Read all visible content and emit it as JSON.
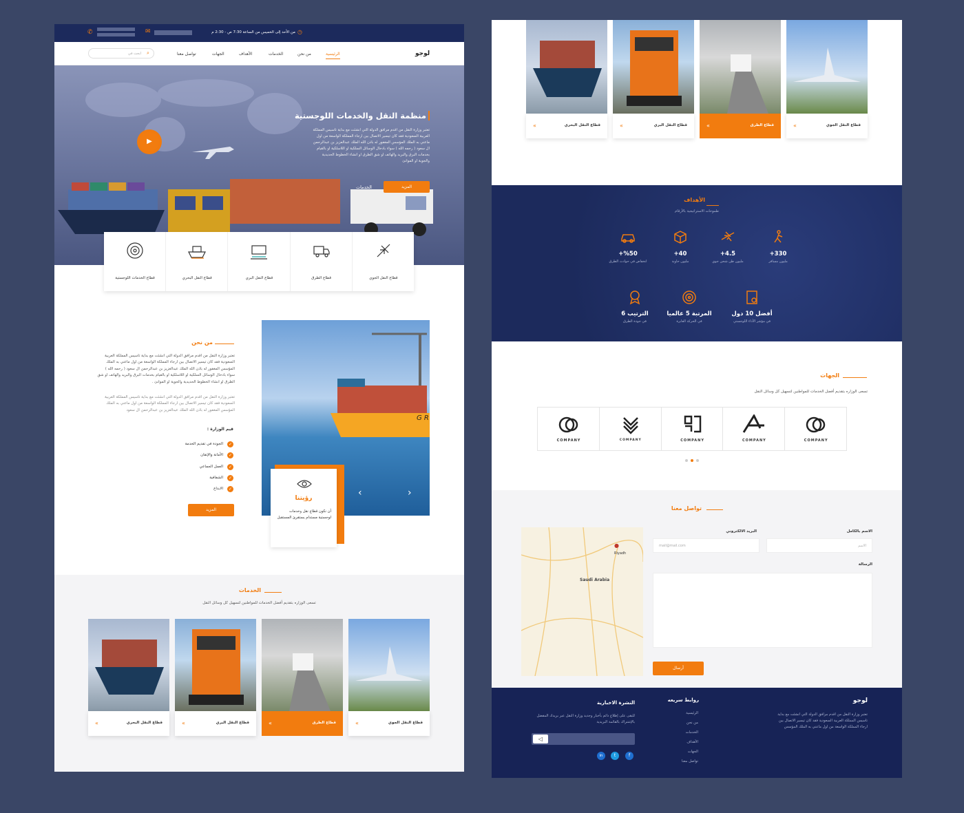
{
  "topbar": {
    "hours": "من الأحد إلى الخميس من الساعة 7:30 ص - 2:30 م"
  },
  "nav": {
    "logo": "لوجو",
    "items": [
      "الرئيسية",
      "من نحن",
      "الخدمات",
      "الأهداف",
      "الجهات",
      "تواصل معنا"
    ],
    "search_placeholder": "ابحث في"
  },
  "hero": {
    "title": "منظمة النقل والخدمات اللوجستية",
    "body": "تعتبر وزارة النقل من اقدم مرافق الدولة التي انشئت مع بداية تاسيس المملكة العربية السعودية فقد كان تيسير الاتصال بين ارجاء المملكة الواسعة من اول ماعني به الملك المؤسس المغفور له باذن الله الملك عبدالعزيز بن عبدالرحمن ال سعود ( رحمه الله ) سواء بادخال الوسائل السلكية او اللاسلكية او بالقيام بخدمات البرق والبريد والهاتف او شق الطرق او انشاء الخطوط الحديدية والجوية او الموانئ",
    "more": "المزيد",
    "services": "الخدمات"
  },
  "sectors": [
    {
      "label": "قطاع الخدمات اللوجستية",
      "icon": "logistics-icon"
    },
    {
      "label": "قطاع النقل البحري",
      "icon": "ship-icon"
    },
    {
      "label": "قطاع النقل البري",
      "icon": "train-icon"
    },
    {
      "label": "قطاع الطرق",
      "icon": "truck-icon"
    },
    {
      "label": "قطاع النقل الجوي",
      "icon": "plane-icon"
    }
  ],
  "about": {
    "title": "من نحن",
    "p1": "تعتبر وزارة النقل من اقدم مرافق الدولة التي انشئت مع بداية تاسيس المملكة العربية السعودية فقد كان تيسير الاتصال بين ارجاء المملكة الواسعة من اول ماعني به الملك المؤسس المغفور له باذن الله الملك عبدالعزيز بن عبدالرحمن ال سعود ( رحمه الله ) سواء بادخال الوسائل السلكية او اللاسلكية او بالقيام بخدمات البرق والبريد والهاتف او شق الطرق او انشاء الخطوط الحديدية والجوية او الموانئ .",
    "p2": "تعتبر وزارة النقل من اقدم مرافق الدولة التي انشئت مع بداية تاسيس المملكة العربية السعودية فقد كان تيسير الاتصال بين ارجاء المملكة الواسعة من اول ماعني به الملك المؤسس المغفور له باذن الله الملك عبدالعزيز بن عبدالرحمن ال سعود",
    "values_title": "قيم الوزارة :",
    "values": [
      "الجودة في تقديم الخدمة",
      "الأمانة والإتقان",
      "العمل الجماعي",
      "الشفافية",
      "الابداع"
    ],
    "more": "المزيد",
    "vision_title": "رؤيتنا",
    "vision_text": "أن نكون قطاع نقل وخدمات لوجستية مستدام يستقرئ المستقبل"
  },
  "services": {
    "title": "الخدمات",
    "subtitle": "تسعى الوزاره بتقديم أفضل الخدمات للمواطنين لتسهيل كل وسائل النقل",
    "cards": [
      "قطاع النقل البحري",
      "قطاع النقل البري",
      "قطاع الطرق",
      "قطاع النقل الجوي"
    ],
    "arrow": "«"
  },
  "goals": {
    "title": "الأهداف",
    "subtitle": "طموحات الاستراتيجية بالأرقام",
    "row1": [
      {
        "value": "+330",
        "label": "مليون مسافر",
        "icon": "walker-icon"
      },
      {
        "value": "+4.5",
        "label": "مليون طن شحن جوي",
        "icon": "plane-icon"
      },
      {
        "value": "+40",
        "label": "مليون حاوية",
        "icon": "box-icon"
      },
      {
        "value": "+%50",
        "label": "انخفاض في حوادث الطرق",
        "icon": "car-icon"
      }
    ],
    "row2": [
      {
        "value": "أفضل 10 دول",
        "label": "في مؤشر الأداء اللوجستي",
        "icon": "report-icon"
      },
      {
        "value": "المرتبة 5 عالميا",
        "label": "في الحركة العابرة",
        "icon": "target-icon"
      },
      {
        "value": "الترتيب 6",
        "label": "في جودة الطرق",
        "icon": "medal-icon"
      }
    ]
  },
  "partners": {
    "title": "الجهات",
    "subtitle": "تسعى الوزاره بتقديم أفضل الخدمات للمواطنين لتسهيل كل وسائل النقل",
    "logos": [
      "COMPANY",
      "COMPANY",
      "COMPANY",
      "COMPANY",
      "COMPANY"
    ]
  },
  "contact": {
    "title": "تواصل معنا",
    "name_label": "الاسم بالكامل",
    "name_placeholder": "الاسم",
    "email_label": "البريد الالكتروني",
    "email_placeholder": "mail@mail.com",
    "message_label": "الرسالة",
    "send": "أرسال",
    "map_country": "Saudi Arabia",
    "map_city": "Riyadh"
  },
  "footer": {
    "logo": "لوجو",
    "about": "تعتبر وزارة النقل من اقدم مرافق الدولة التي انشئت مع بداية تاسيس المملكة العربية السعودية فقد كان تيسير الاتصال بين ارجاء المملكة الواسعة من اول ماعني به الملك المؤسس",
    "links_title": "روابط سريعه",
    "links": [
      "الرئيسية",
      "من نحن",
      "الخدمات",
      "الأهداف",
      "الجهات",
      "تواصل معنا"
    ],
    "news_title": "النشرة الاخبارية",
    "news_text": "للبقى على إطلاع دائم بأخبار وجديد وزارة النقل عبر بريدك المفضل بالإشتراك بالقائمة البريدية"
  },
  "colors": {
    "orange": "#f27c0f",
    "navy": "#1c2a5c",
    "bg": "#3a4666"
  }
}
